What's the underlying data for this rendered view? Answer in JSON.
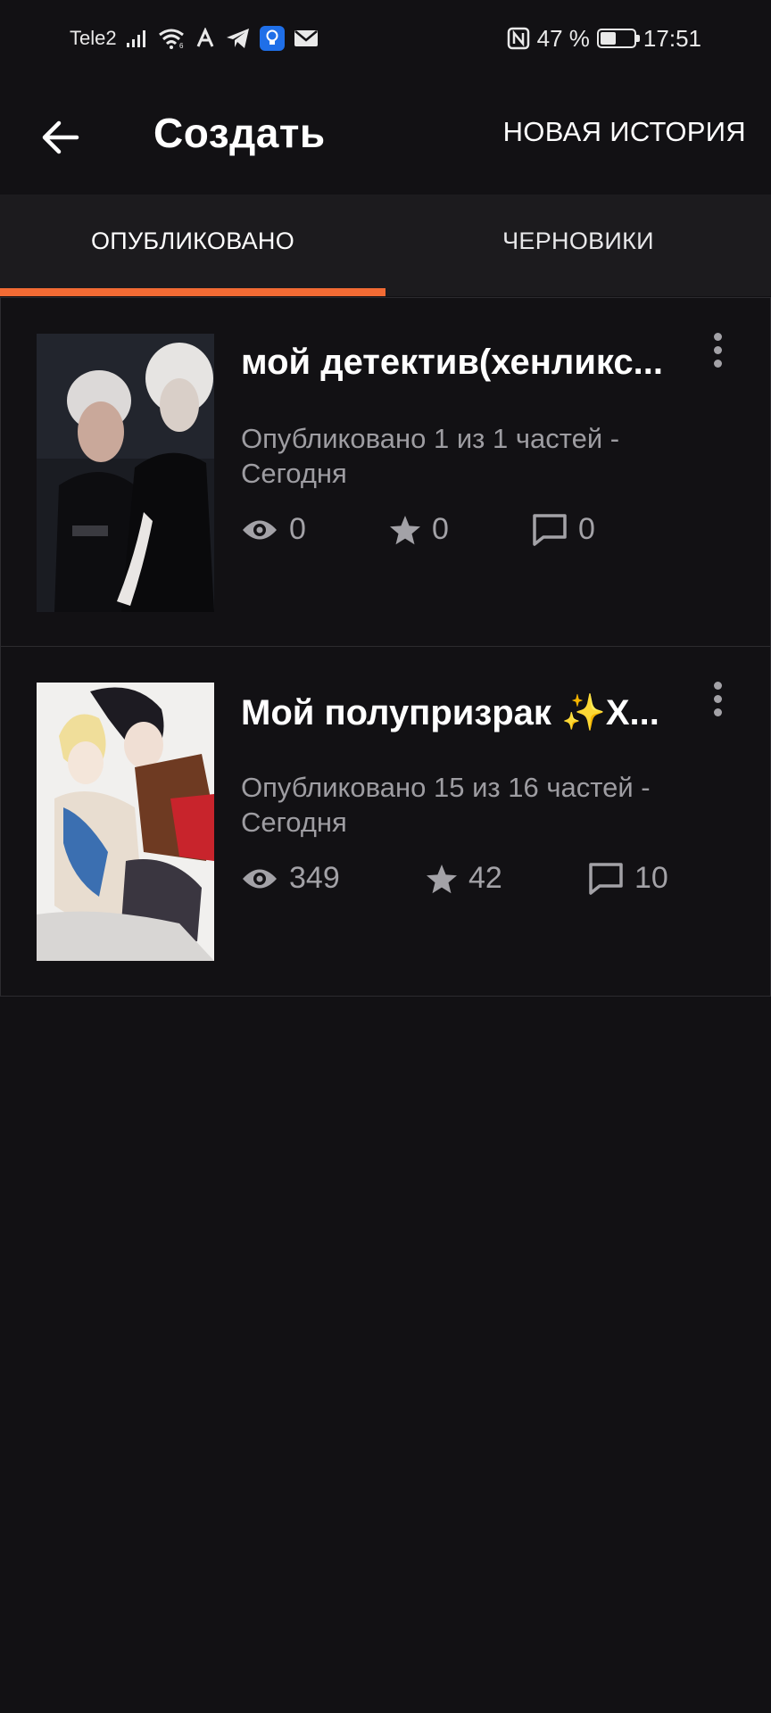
{
  "status_bar": {
    "carrier": "Tele2",
    "battery_percent": "47 %",
    "battery_level": 0.47,
    "time": "17:51",
    "icons": [
      "signal-icon",
      "wifi-icon",
      "font-app-icon",
      "telegram-icon",
      "bulb-app-icon",
      "mail-icon",
      "nfc-icon",
      "battery-icon"
    ]
  },
  "app_bar": {
    "title": "Создать",
    "action_label": "НОВАЯ ИСТОРИЯ",
    "back_icon": "arrow-left-icon"
  },
  "tabs": [
    {
      "label": "ОПУБЛИКОВАНО",
      "active": true
    },
    {
      "label": "ЧЕРНОВИКИ",
      "active": false
    }
  ],
  "accent_color": "#f26b34",
  "stories": [
    {
      "title": "мой детектив(хенликс...",
      "meta": "Опубликовано 1 из 1 частей - Сегодня",
      "views": "0",
      "stars": "0",
      "comments": "0"
    },
    {
      "title": "Мой полупризрак ✨Х...",
      "meta": "Опубликовано 15 из 16 частей - Сегодня",
      "views": "349",
      "stars": "42",
      "comments": "10"
    }
  ]
}
